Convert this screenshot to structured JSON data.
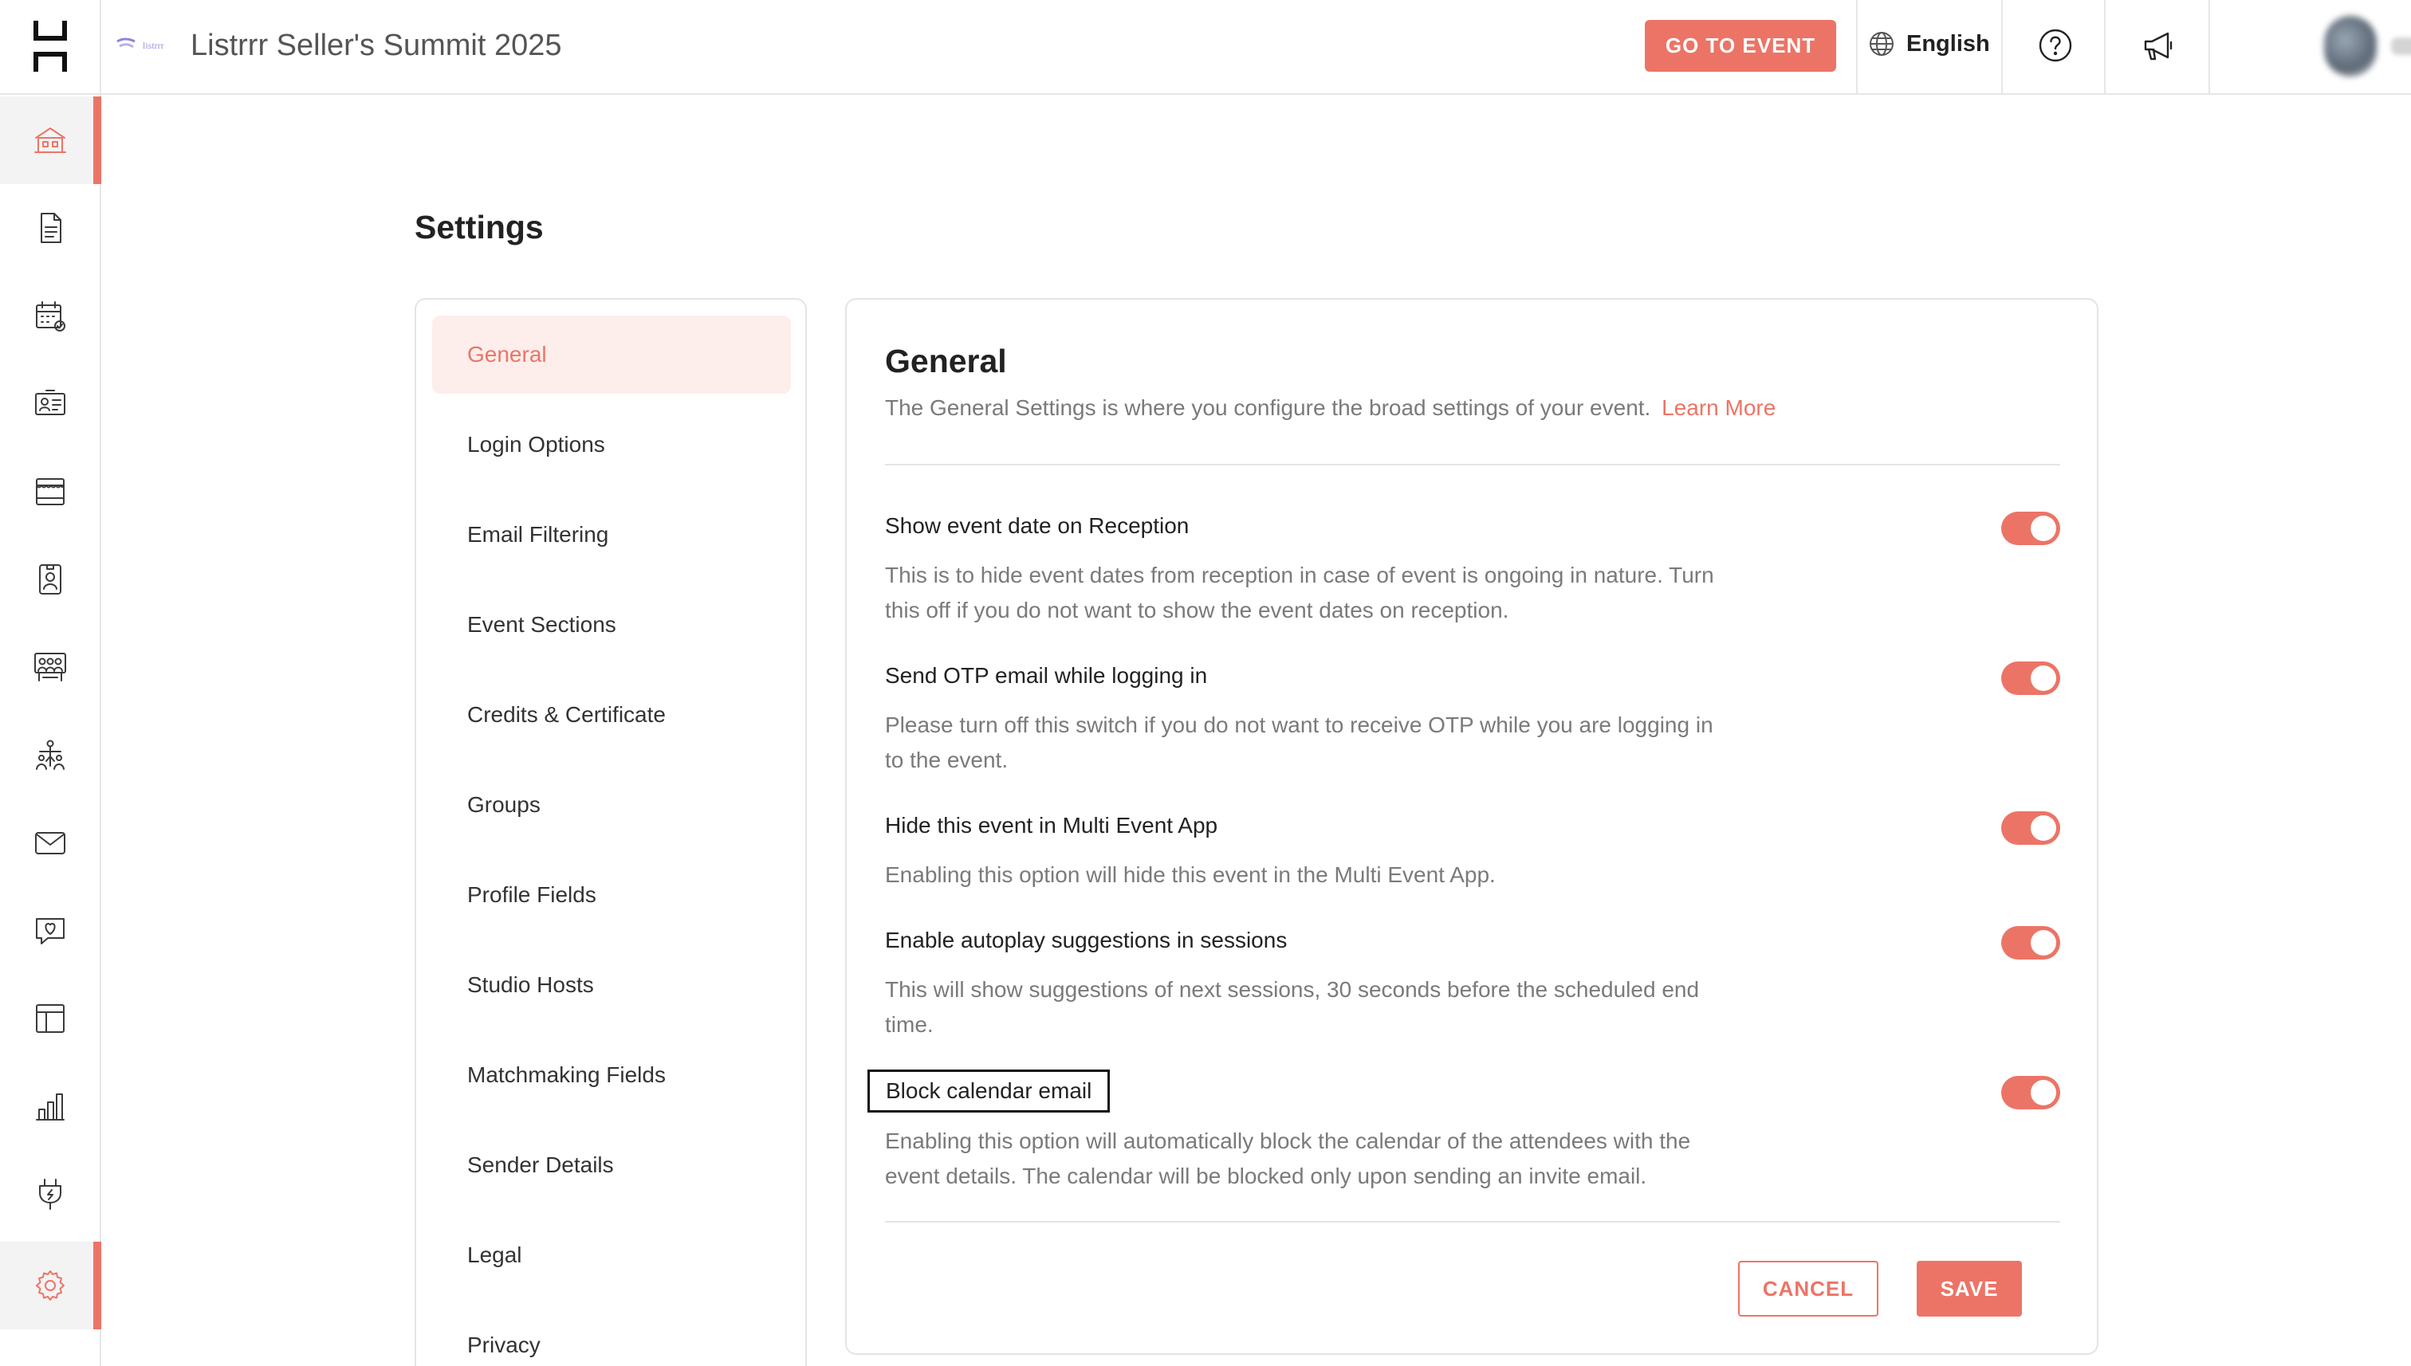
{
  "app": {
    "event_title": "Listrrr Seller's Summit 2025",
    "brand_mini_text": "listrrr",
    "accent_color": "#ec7466"
  },
  "topbar": {
    "go_to_event_label": "GO TO EVENT",
    "language_label": "English",
    "icons": [
      "globe-icon",
      "help-icon",
      "megaphone-icon",
      "avatar",
      "chevron-down-icon"
    ]
  },
  "rail": {
    "logo": "hubilo-logo",
    "items": [
      {
        "icon": "venue-icon",
        "active": true
      },
      {
        "icon": "document-icon",
        "active": false
      },
      {
        "icon": "calendar-icon",
        "active": false
      },
      {
        "icon": "id-card-icon",
        "active": false
      },
      {
        "icon": "booth-icon",
        "active": false
      },
      {
        "icon": "badge-icon",
        "active": false
      },
      {
        "icon": "lounge-icon",
        "active": false
      },
      {
        "icon": "networking-icon",
        "active": false
      },
      {
        "icon": "mail-icon",
        "active": false
      },
      {
        "icon": "engagement-icon",
        "active": false
      },
      {
        "icon": "layout-icon",
        "active": false
      },
      {
        "icon": "analytics-icon",
        "active": false
      },
      {
        "icon": "plugin-icon",
        "active": false
      },
      {
        "icon": "settings-icon",
        "active": true
      }
    ]
  },
  "page": {
    "title": "Settings"
  },
  "settings_nav": {
    "items": [
      {
        "label": "General",
        "active": true
      },
      {
        "label": "Login Options",
        "active": false
      },
      {
        "label": "Email Filtering",
        "active": false
      },
      {
        "label": "Event Sections",
        "active": false
      },
      {
        "label": "Credits & Certificate",
        "active": false
      },
      {
        "label": "Groups",
        "active": false
      },
      {
        "label": "Profile Fields",
        "active": false
      },
      {
        "label": "Studio Hosts",
        "active": false
      },
      {
        "label": "Matchmaking Fields",
        "active": false
      },
      {
        "label": "Sender Details",
        "active": false
      },
      {
        "label": "Legal",
        "active": false
      },
      {
        "label": "Privacy",
        "active": false
      }
    ]
  },
  "general": {
    "title": "General",
    "description": "The General Settings is where you configure the broad settings of your event.",
    "learn_more": "Learn More",
    "settings": [
      {
        "title": "Show event date on Reception",
        "description": "This is to hide event dates from reception in case of event is ongoing in nature. Turn this off if you do not want to show the event dates on reception.",
        "enabled": true
      },
      {
        "title": "Send OTP email while logging in",
        "description": "Please turn off this switch if you do not want to receive OTP while you are logging in to the event.",
        "enabled": true
      },
      {
        "title": "Hide this event in Multi Event App",
        "description": "Enabling this option will hide this event in the Multi Event App.",
        "enabled": true
      },
      {
        "title": "Enable autoplay suggestions in sessions",
        "description": "This will show suggestions of next sessions, 30 seconds before the scheduled end time.",
        "enabled": true
      },
      {
        "title": "Block calendar email",
        "description": "Enabling this option will automatically block the calendar of the attendees with the event details. The calendar will be blocked only upon sending an invite email.",
        "enabled": true
      }
    ],
    "cancel_label": "CANCEL",
    "save_label": "SAVE"
  }
}
